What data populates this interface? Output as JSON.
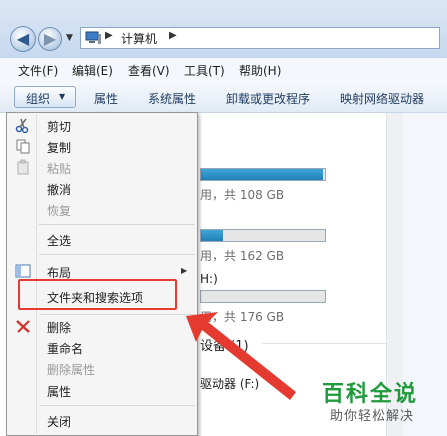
{
  "address": {
    "location": "计算机"
  },
  "menubar": {
    "items": [
      "文件(F)",
      "编辑(E)",
      "查看(V)",
      "工具(T)",
      "帮助(H)"
    ]
  },
  "toolbar": {
    "organize": "组织",
    "items": [
      "属性",
      "系统属性",
      "卸载或更改程序",
      "映射网络驱动器"
    ]
  },
  "drives": [
    {
      "text": "用，共 108 GB",
      "fill": 0.98
    },
    {
      "text": "用，共 162 GB",
      "fill": 0.18
    },
    {
      "text": "用，共 176 GB",
      "fill": 0.0
    }
  ],
  "background": {
    "drive_letter_suffix": "H:)",
    "section_title": "设备 (1)",
    "optical_drive": "驱动器 (F:)"
  },
  "context_menu": {
    "cut": "剪切",
    "copy": "复制",
    "paste": "粘贴",
    "undo": "撤消",
    "redo": "恢复",
    "select_all": "全选",
    "layout": "布局",
    "folder_options": "文件夹和搜索选项",
    "delete": "删除",
    "rename": "重命名",
    "remove_properties": "删除属性",
    "properties": "属性",
    "close": "关闭"
  },
  "watermark": {
    "main": "百科全说",
    "sub": "助你轻松解决"
  },
  "colors": {
    "highlight": "#e43a30",
    "accent": "#1f7fb8",
    "watermark": "#1f9b3d"
  }
}
